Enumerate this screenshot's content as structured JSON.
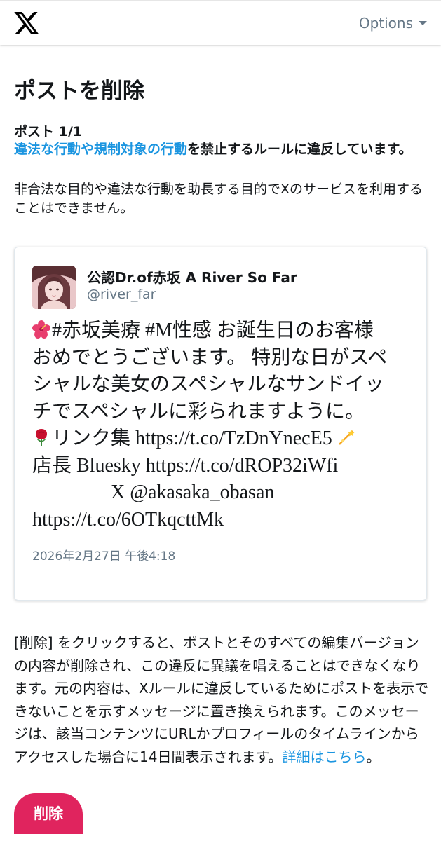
{
  "header": {
    "logo_icon": "x-logo-icon",
    "options_label": "Options"
  },
  "page": {
    "title": "ポストを削除",
    "post_count": "ポスト 1/1",
    "rule_link": "違法な行動や規制対象の行動",
    "rule_text": "を禁止するルールに違反しています。",
    "rule_description": "非合法な目的や違法な行動を助長する目的でXのサービスを利用することはできません。"
  },
  "tweet": {
    "author_name": "公認Dr.of赤坂 A River So Far",
    "author_handle": "@river_far",
    "lines": [
      "#赤坂美療 #M性感 お誕生日のお客様",
      "おめでとうございます。 特別な日がスペ",
      "シャルな美女のスペシャルなサンドイッ",
      "チでスペシャルに彩られますように。",
      "リンク集 https://t.co/TzDnYnecE5",
      "店長 Bluesky https://t.co/dROP32iWfi",
      "X @akasaka_obasan",
      "https://t.co/6OTkqcttMk"
    ],
    "emojis": [
      "hibiscus-icon",
      "rose-icon",
      "dizzy-icon"
    ],
    "date": "2026年2月27日 午後4:18"
  },
  "notice": {
    "text": "[削除] をクリックすると、ポストとそのすべての編集バージョンの内容が削除され、この違反に異議を唱えることはできなくなります。元の内容は、Xルールに違反しているためにポストを表示できないことを示すメッセージに置き換えられます。このメッセージは、該当コンテンツにURLかプロフィールのタイムラインからアクセスした場合に14日間表示されます。",
    "link_text": "詳細はこちら",
    "suffix": "。"
  },
  "actions": {
    "delete_label": "削除"
  },
  "colors": {
    "link": "#1b95e0",
    "delete": "#e0245e",
    "muted": "#657786"
  }
}
